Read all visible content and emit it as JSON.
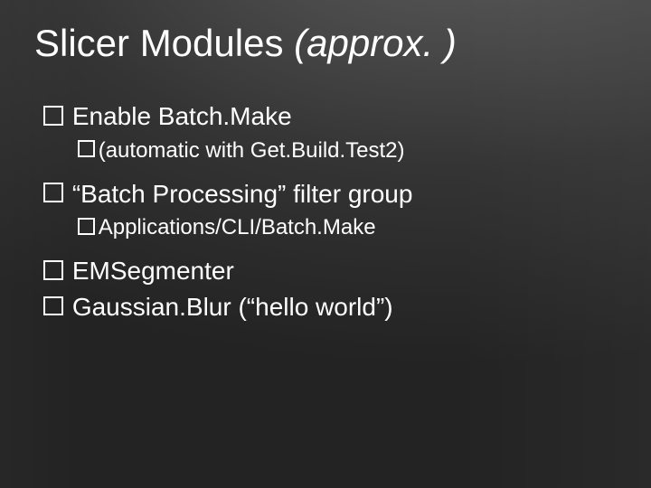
{
  "title": {
    "main": "Slicer Modules ",
    "italic": "(approx. )"
  },
  "bullets": {
    "b1": "Enable Batch.Make",
    "b1_sub": "(automatic with Get.Build.Test2)",
    "b2": "“Batch Processing” filter group",
    "b2_sub": "Applications/CLI/Batch.Make",
    "b3": "EMSegmenter",
    "b4": "Gaussian.Blur (“hello world”)"
  }
}
